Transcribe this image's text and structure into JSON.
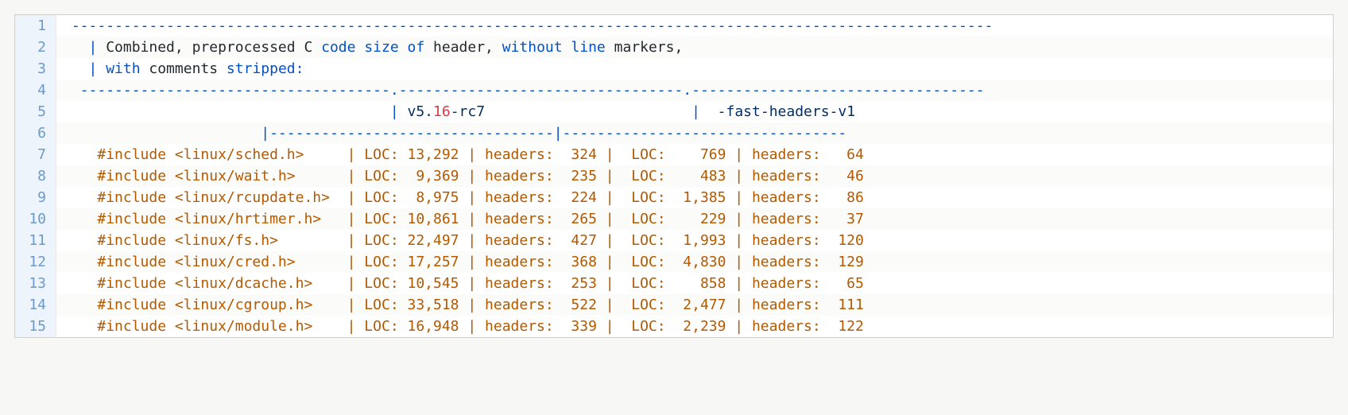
{
  "header_text": {
    "line1_a": "|",
    "line1_b": " Combined, preprocessed C",
    "line1_c": " code size of",
    "line1_d": " header,",
    "line1_e": " without line",
    "line1_f": " markers,",
    "line2_a": "|",
    "line2_b": " with",
    "line2_c": " comments",
    "line2_d": " stripped:"
  },
  "dash_top": "-----------------------------------------------------------------------------------------------------------",
  "dash_mid": "------------------------------------.---------------------------------.----------------------------------",
  "col_heads": {
    "pad1": "                                    | ",
    "h1a": "v5.",
    "h1b": "16",
    "h1c": "-rc7",
    "pad2": "                        |  ",
    "h2": "-fast-headers-v1"
  },
  "dash_sub": "                     |---------------------------------|---------------------------------",
  "rows": [
    {
      "inc": "  #include <linux/sched.h>     | LOC: 13,292 | headers:  324 |  LOC:    769 | headers:   64"
    },
    {
      "inc": "  #include <linux/wait.h>      | LOC:  9,369 | headers:  235 |  LOC:    483 | headers:   46"
    },
    {
      "inc": "  #include <linux/rcupdate.h>  | LOC:  8,975 | headers:  224 |  LOC:  1,385 | headers:   86"
    },
    {
      "inc": "  #include <linux/hrtimer.h>   | LOC: 10,861 | headers:  265 |  LOC:    229 | headers:   37"
    },
    {
      "inc": "  #include <linux/fs.h>        | LOC: 22,497 | headers:  427 |  LOC:  1,993 | headers:  120"
    },
    {
      "inc": "  #include <linux/cred.h>      | LOC: 17,257 | headers:  368 |  LOC:  4,830 | headers:  129"
    },
    {
      "inc": "  #include <linux/dcache.h>    | LOC: 10,545 | headers:  253 |  LOC:    858 | headers:   65"
    },
    {
      "inc": "  #include <linux/cgroup.h>    | LOC: 33,518 | headers:  522 |  LOC:  2,477 | headers:  111"
    },
    {
      "inc": "  #include <linux/module.h>    | LOC: 16,948 | headers:  339 |  LOC:  2,239 | headers:  122"
    }
  ],
  "line_numbers": [
    "1",
    "2",
    "3",
    "4",
    "5",
    "6",
    "7",
    "8",
    "9",
    "10",
    "11",
    "12",
    "13",
    "14",
    "15"
  ],
  "chart_data": {
    "type": "table",
    "title": "Combined, preprocessed C code size of header, without line markers, with comments stripped",
    "columns": [
      "header",
      "v5.16-rc7 LOC",
      "v5.16-rc7 headers",
      "-fast-headers-v1 LOC",
      "-fast-headers-v1 headers"
    ],
    "data": [
      {
        "header": "#include <linux/sched.h>",
        "v5_loc": 13292,
        "v5_headers": 324,
        "fast_loc": 769,
        "fast_headers": 64
      },
      {
        "header": "#include <linux/wait.h>",
        "v5_loc": 9369,
        "v5_headers": 235,
        "fast_loc": 483,
        "fast_headers": 46
      },
      {
        "header": "#include <linux/rcupdate.h>",
        "v5_loc": 8975,
        "v5_headers": 224,
        "fast_loc": 1385,
        "fast_headers": 86
      },
      {
        "header": "#include <linux/hrtimer.h>",
        "v5_loc": 10861,
        "v5_headers": 265,
        "fast_loc": 229,
        "fast_headers": 37
      },
      {
        "header": "#include <linux/fs.h>",
        "v5_loc": 22497,
        "v5_headers": 427,
        "fast_loc": 1993,
        "fast_headers": 120
      },
      {
        "header": "#include <linux/cred.h>",
        "v5_loc": 17257,
        "v5_headers": 368,
        "fast_loc": 4830,
        "fast_headers": 129
      },
      {
        "header": "#include <linux/dcache.h>",
        "v5_loc": 10545,
        "v5_headers": 253,
        "fast_loc": 858,
        "fast_headers": 65
      },
      {
        "header": "#include <linux/cgroup.h>",
        "v5_loc": 33518,
        "v5_headers": 522,
        "fast_loc": 2477,
        "fast_headers": 111
      },
      {
        "header": "#include <linux/module.h>",
        "v5_loc": 16948,
        "v5_headers": 339,
        "fast_loc": 2239,
        "fast_headers": 122
      }
    ]
  }
}
